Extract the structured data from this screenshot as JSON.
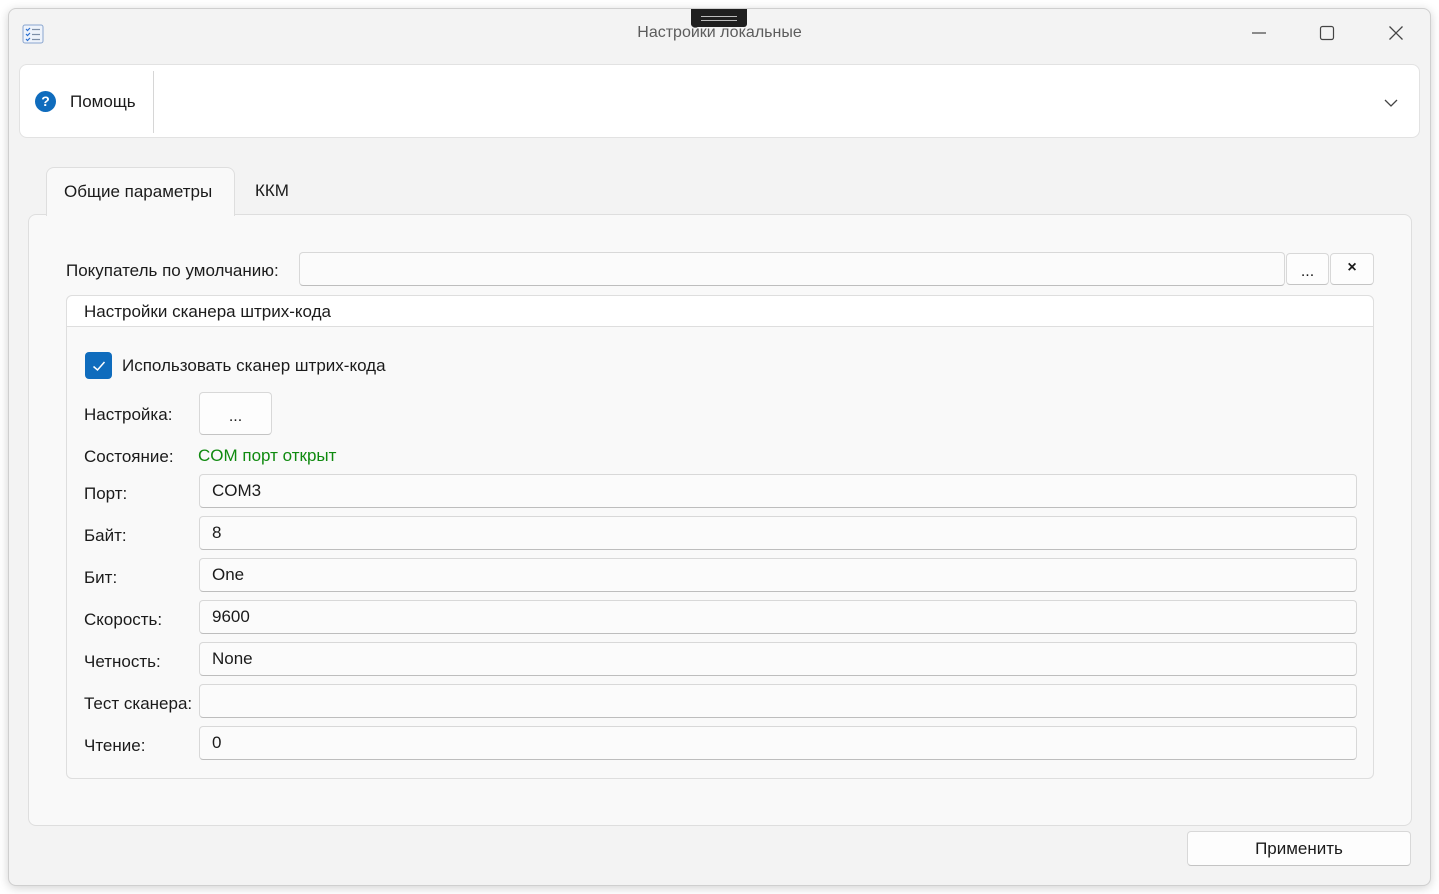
{
  "window": {
    "title": "Настройки локальные",
    "icons": {
      "app": "settings-list-icon",
      "minimize": "minimize-icon",
      "maximize": "maximize-icon",
      "close": "close-icon"
    }
  },
  "help": {
    "label": "Помощь",
    "icon": "help-icon",
    "expand_icon": "chevron-down-icon"
  },
  "tabs": [
    {
      "label": "Общие параметры",
      "selected": true
    },
    {
      "label": "ККМ",
      "selected": false
    }
  ],
  "general": {
    "default_buyer_label": "Покупатель по умолчанию:",
    "default_buyer_value": "",
    "browse_label": "...",
    "clear_label": "×",
    "scanner_group": {
      "title": "Настройки сканера штрих-кода",
      "use_scanner_label": "Использовать сканер штрих-кода",
      "use_scanner_checked": true,
      "setup_label": "Настройка:",
      "setup_button": "...",
      "status_label": "Состояние:",
      "status_value": "COM порт открыт",
      "status_color": "#0f8a0f",
      "fields": [
        {
          "label": "Порт:",
          "value": "COM3"
        },
        {
          "label": "Байт:",
          "value": "8"
        },
        {
          "label": "Бит:",
          "value": "One"
        },
        {
          "label": "Скорость:",
          "value": "9600"
        },
        {
          "label": "Четность:",
          "value": "None"
        },
        {
          "label": "Тест сканера:",
          "value": ""
        },
        {
          "label": "Чтение:",
          "value": "0"
        }
      ]
    }
  },
  "footer": {
    "apply_label": "Применить"
  },
  "colors": {
    "accent": "#0f6cbd",
    "status_ok": "#0f8a0f"
  }
}
